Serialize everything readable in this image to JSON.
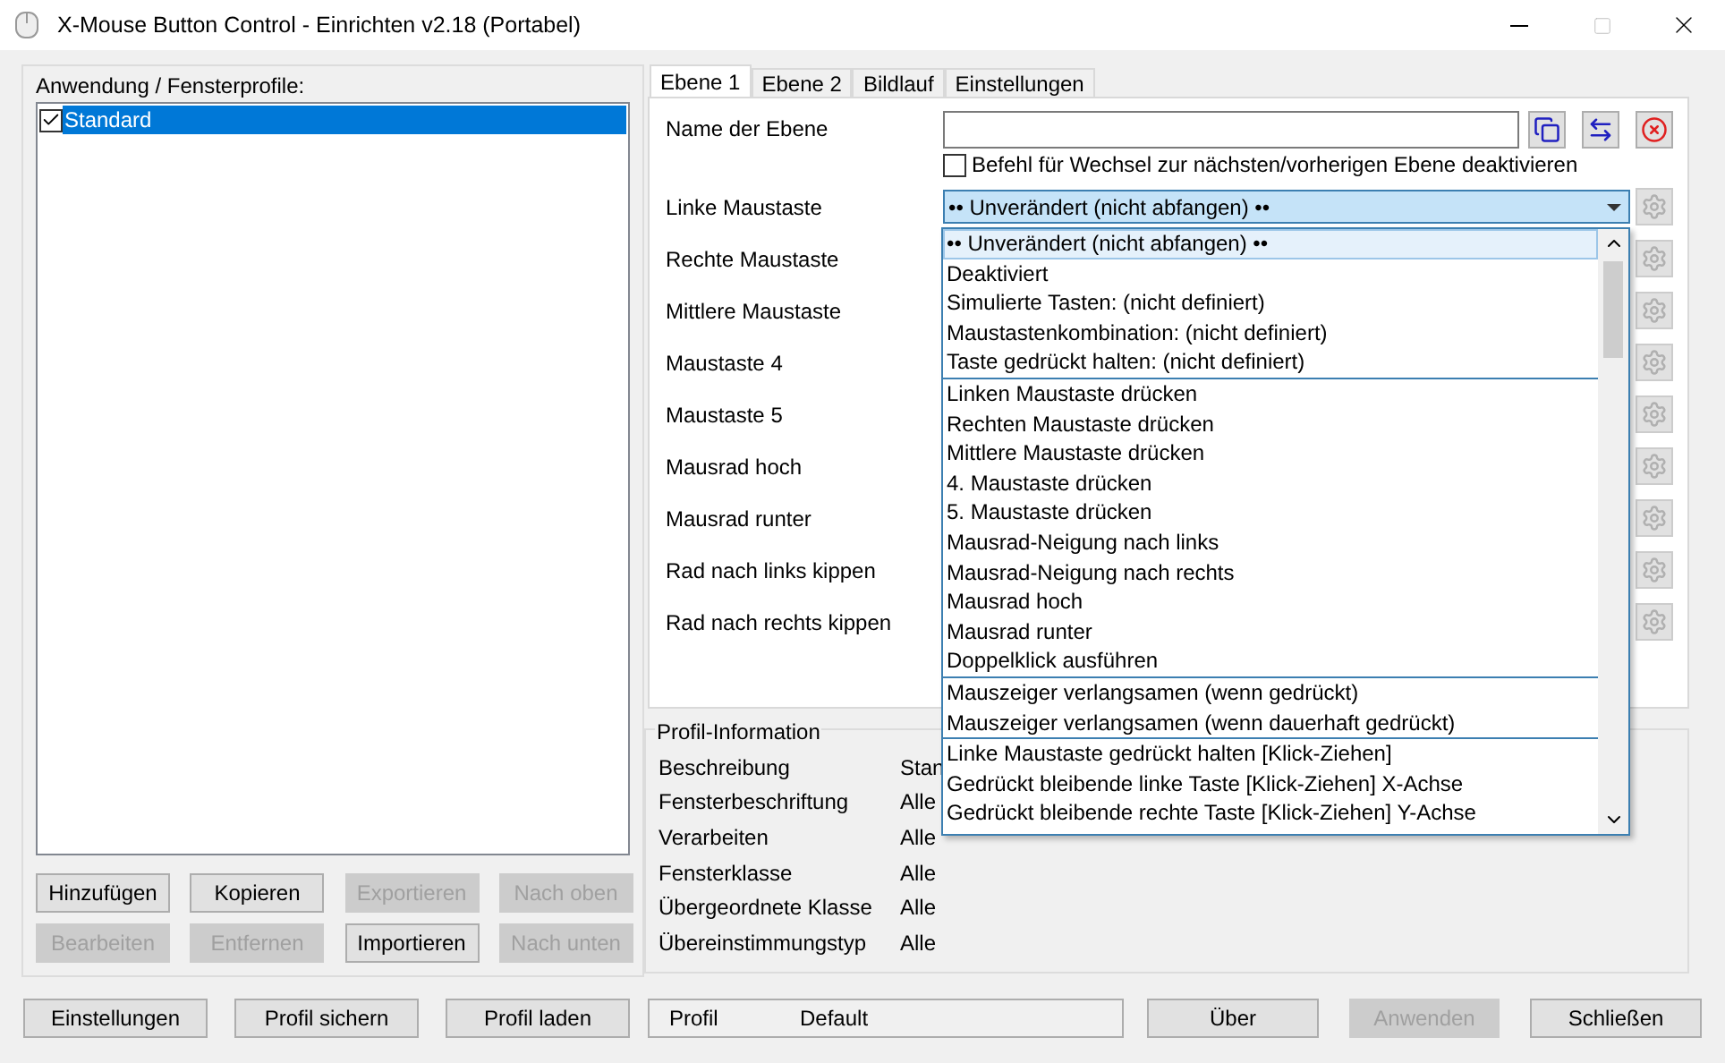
{
  "window": {
    "title": "X-Mouse Button Control - Einrichten v2.18 (Portabel)"
  },
  "profiles": {
    "label": "Anwendung / Fensterprofile:",
    "items": [
      {
        "name": "Standard",
        "checked": true,
        "selected": true
      }
    ],
    "buttons": [
      {
        "label": "Hinzufügen",
        "disabled": false
      },
      {
        "label": "Kopieren",
        "disabled": false
      },
      {
        "label": "Exportieren",
        "disabled": true
      },
      {
        "label": "Nach oben",
        "disabled": true
      },
      {
        "label": "Bearbeiten",
        "disabled": true
      },
      {
        "label": "Entfernen",
        "disabled": true
      },
      {
        "label": "Importieren",
        "disabled": false
      },
      {
        "label": "Nach unten",
        "disabled": true
      }
    ]
  },
  "tabs": [
    {
      "label": "Ebene 1",
      "selected": true
    },
    {
      "label": "Ebene 2",
      "selected": false
    },
    {
      "label": "Bildlauf",
      "selected": false
    },
    {
      "label": "Einstellungen",
      "selected": false
    }
  ],
  "layer": {
    "name_label": "Name der Ebene",
    "disable_switch": {
      "label": "Befehl für Wechsel zur nächsten/vorherigen Ebene deaktivieren",
      "checked": false
    },
    "rows": [
      {
        "label": "Linke Maustaste",
        "value": "•• Unverändert (nicht abfangen) ••"
      },
      {
        "label": "Rechte Maustaste"
      },
      {
        "label": "Mittlere Maustaste"
      },
      {
        "label": "Maustaste 4"
      },
      {
        "label": "Maustaste 5"
      },
      {
        "label": "Mausrad hoch"
      },
      {
        "label": "Mausrad runter"
      },
      {
        "label": "Rad nach links kippen"
      },
      {
        "label": "Rad nach rechts kippen"
      }
    ]
  },
  "dropdown": {
    "groups": [
      {
        "items": [
          {
            "label": "•• Unverändert (nicht abfangen) ••",
            "selected": true
          },
          {
            "label": "Deaktiviert",
            "selected": false
          },
          {
            "label": "Simulierte Tasten: (nicht definiert)",
            "selected": false
          },
          {
            "label": "Maustastenkombination: (nicht definiert)",
            "selected": false
          },
          {
            "label": "Taste gedrückt halten: (nicht definiert)",
            "selected": false
          }
        ]
      },
      {
        "items": [
          {
            "label": "Linken Maustaste drücken",
            "selected": false
          },
          {
            "label": "Rechten Maustaste drücken",
            "selected": false
          },
          {
            "label": "Mittlere Maustaste drücken",
            "selected": false
          },
          {
            "label": "4. Maustaste drücken",
            "selected": false
          },
          {
            "label": "5. Maustaste drücken",
            "selected": false
          },
          {
            "label": "Mausrad-Neigung nach links",
            "selected": false
          },
          {
            "label": "Mausrad-Neigung nach rechts",
            "selected": false
          },
          {
            "label": "Mausrad hoch",
            "selected": false
          },
          {
            "label": "Mausrad runter",
            "selected": false
          },
          {
            "label": "Doppelklick ausführen",
            "selected": false
          }
        ]
      },
      {
        "items": [
          {
            "label": "Mauszeiger verlangsamen (wenn gedrückt)",
            "selected": false
          },
          {
            "label": "Mauszeiger verlangsamen (wenn dauerhaft gedrückt)",
            "selected": false
          }
        ]
      },
      {
        "items": [
          {
            "label": "Linke Maustaste gedrückt halten [Klick-Ziehen]",
            "selected": false
          },
          {
            "label": "Gedrückt bleibende linke Taste [Klick-Ziehen] X-Achse",
            "selected": false
          },
          {
            "label": "Gedrückt bleibende rechte Taste [Klick-Ziehen] Y-Achse",
            "selected": false
          }
        ]
      }
    ]
  },
  "profile_info": {
    "title": "Profil-Information",
    "rows": [
      {
        "label": "Beschreibung",
        "value": "Stan"
      },
      {
        "label": "Fensterbeschriftung",
        "value": "Alle"
      },
      {
        "label": "Verarbeiten",
        "value": "Alle"
      },
      {
        "label": "Fensterklasse",
        "value": "Alle"
      },
      {
        "label": "Übergeordnete Klasse",
        "value": "Alle"
      },
      {
        "label": "Übereinstimmungstyp",
        "value": "Alle"
      }
    ]
  },
  "footer": {
    "buttons_left": [
      {
        "label": "Einstellungen",
        "disabled": false
      },
      {
        "label": "Profil sichern",
        "disabled": false
      },
      {
        "label": "Profil laden",
        "disabled": false
      }
    ],
    "status": {
      "label": "Profil",
      "value": "Default"
    },
    "buttons_right": [
      {
        "label": "Über",
        "disabled": false
      },
      {
        "label": "Anwenden",
        "disabled": true
      },
      {
        "label": "Schließen",
        "disabled": false
      }
    ]
  }
}
